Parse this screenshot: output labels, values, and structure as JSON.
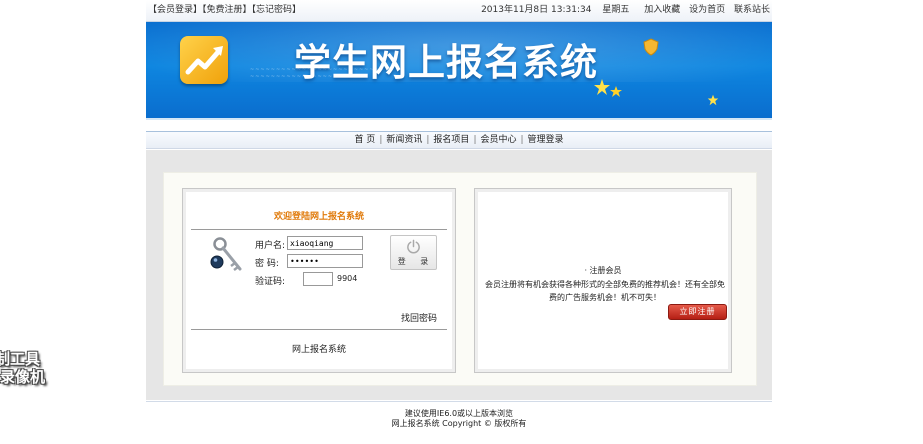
{
  "topbar": {
    "login": "【会员登录】",
    "register": "【免费注册】",
    "forgot": "【忘记密码】",
    "datetime": "2013年11月8日  13:31:34",
    "weekday": "星期五",
    "favorite": "加入收藏",
    "homepage": "设为首页",
    "contact": "联系站长"
  },
  "banner": {
    "title": "学生网上报名系统"
  },
  "nav": {
    "items": [
      "首 页",
      "新闻资讯",
      "报名项目",
      "会员中心",
      "管理登录"
    ]
  },
  "login": {
    "heading": "欢迎登陆网上报名系统",
    "username_label": "用户名:",
    "username_value": "xiaoqiang",
    "password_label": "密  码:",
    "password_value": "123456",
    "captcha_label": "验证码:",
    "captcha_value": "",
    "captcha_code": "9904",
    "login_button": "登 录",
    "find_password": "找回密码",
    "footer": "网上报名系统"
  },
  "register": {
    "heading": "· 注册会员",
    "description": "会员注册将有机会获得各种形式的全部免费的推荐机会！还有全部免费的广告服务机会！机不可失！",
    "button": "立即注册"
  },
  "footer": {
    "line1": "建议使用IE6.0或以上版本浏览",
    "line2": "网上报名系统 Copyright © 版权所有"
  },
  "watermark": {
    "line1": "制工具",
    "line2": "录像机"
  },
  "colors": {
    "banner_blue": "#0a78d8",
    "heading_orange": "#e07a0a",
    "register_red": "#c0281c"
  }
}
